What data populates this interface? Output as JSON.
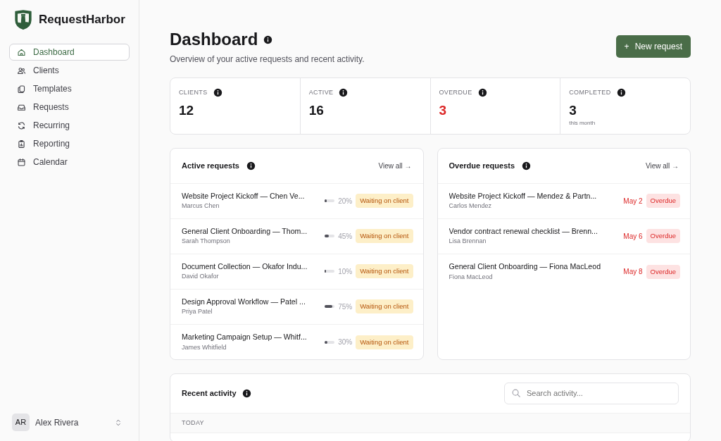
{
  "app": {
    "name": "RequestHarbor"
  },
  "sidebar": {
    "items": [
      {
        "label": "Dashboard",
        "selected": true
      },
      {
        "label": "Clients",
        "selected": false
      },
      {
        "label": "Templates",
        "selected": false
      },
      {
        "label": "Requests",
        "selected": false
      },
      {
        "label": "Recurring",
        "selected": false
      },
      {
        "label": "Reporting",
        "selected": false
      },
      {
        "label": "Calendar",
        "selected": false
      }
    ],
    "user": {
      "initials": "AR",
      "name": "Alex Rivera"
    }
  },
  "header": {
    "title": "Dashboard",
    "subtitle": "Overview of your active requests and recent activity.",
    "button_icon": "+",
    "button": "New request"
  },
  "stats": [
    {
      "label": "CLIENTS",
      "value": "12",
      "alert": false
    },
    {
      "label": "ACTIVE",
      "value": "16",
      "alert": false
    },
    {
      "label": "OVERDUE",
      "value": "3",
      "alert": true
    },
    {
      "label": "COMPLETED",
      "value": "3",
      "alert": false,
      "note": "this month"
    }
  ],
  "active_requests": {
    "title": "Active requests",
    "link": "View all →",
    "rows": [
      {
        "title": "Website Project Kickoff — Chen Ve...",
        "client": "Marcus Chen",
        "level": 0.2,
        "percent": "20%",
        "status": "Waiting on client"
      },
      {
        "title": "General Client Onboarding — Thom...",
        "client": "Sarah Thompson",
        "level": 0.45,
        "percent": "45%",
        "status": "Waiting on client"
      },
      {
        "title": "Document Collection — Okafor Indu...",
        "client": "David Okafor",
        "level": 0.1,
        "percent": "10%",
        "status": "Waiting on client"
      },
      {
        "title": "Design Approval Workflow — Patel ...",
        "client": "Priya Patel",
        "level": 0.75,
        "percent": "75%",
        "status": "Waiting on client"
      },
      {
        "title": "Marketing Campaign Setup — Whitf...",
        "client": "James Whitfield",
        "level": 0.3,
        "percent": "30%",
        "status": "Waiting on client"
      }
    ]
  },
  "overdue_requests": {
    "title": "Overdue requests",
    "link": "View all →",
    "rows": [
      {
        "title": "Website Project Kickoff — Mendez & Partn...",
        "client": "Carlos Mendez",
        "date": "May 2",
        "status": "Overdue"
      },
      {
        "title": "Vendor contract renewal checklist — Brenn...",
        "client": "Lisa Brennan",
        "date": "May 6",
        "status": "Overdue"
      },
      {
        "title": "General Client Onboarding — Fiona MacLeod",
        "client": "Fiona MacLeod",
        "date": "May 8",
        "status": "Overdue"
      }
    ]
  },
  "recent_activity": {
    "title": "Recent activity",
    "search": {
      "placeholder": "Search activity..."
    },
    "groups": [
      {
        "label": "TODAY"
      }
    ]
  }
}
